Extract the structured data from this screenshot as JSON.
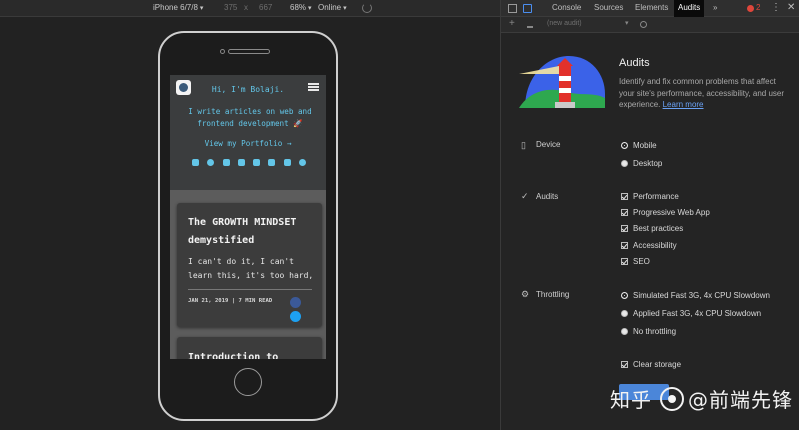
{
  "device_toolbar": {
    "device": "iPhone 6/7/8",
    "width": "375",
    "times": "x",
    "height": "667",
    "zoom": "68%",
    "network": "Online"
  },
  "phone_page": {
    "greeting": "Hi, I'm Bolaji.",
    "bio": "I write articles on web and frontend development 🚀",
    "portfolio_link": "View my Portfolio →",
    "social_icons": [
      "email-icon",
      "github-icon",
      "twitter-icon",
      "linkedin-icon",
      "facebook-icon",
      "instagram-icon",
      "youtube-icon",
      "rss-icon"
    ],
    "cards": [
      {
        "title": "The GROWTH MINDSET demystified",
        "excerpt": "I can't do it, I can't learn this, it's too hard,",
        "meta": "JAN 21, 2019 | 7 MIN READ"
      },
      {
        "title": "Introduction to JavaScript Switch"
      }
    ]
  },
  "devtools": {
    "tabs": [
      "Console",
      "Sources",
      "Elements",
      "Audits"
    ],
    "active_tab": "Audits",
    "more_tabs": "»",
    "error_count": "2",
    "menu": "⋮",
    "close": "✕",
    "audit_select": "(new audit)",
    "audits": {
      "title": "Audits",
      "description": "Identify and fix common problems that affect your site's performance, accessibility, and user experience.",
      "learn_more": "Learn more",
      "device": {
        "label": "Device",
        "options": [
          "Mobile",
          "Desktop"
        ],
        "selected": "Mobile"
      },
      "audits_section": {
        "label": "Audits",
        "options": [
          "Performance",
          "Progressive Web App",
          "Best practices",
          "Accessibility",
          "SEO"
        ]
      },
      "throttling": {
        "label": "Throttling",
        "options": [
          "Simulated Fast 3G, 4x CPU Slowdown",
          "Applied Fast 3G, 4x CPU Slowdown",
          "No throttling"
        ],
        "selected": "Simulated Fast 3G, 4x CPU Slowdown"
      },
      "clear_storage": "Clear storage"
    }
  },
  "watermark": {
    "left": "知乎",
    "right": "@前端先锋"
  },
  "colors": {
    "accent_cyan": "#63c6e8",
    "devtools_blue": "#4b86d9",
    "error_red": "#e0463b"
  }
}
